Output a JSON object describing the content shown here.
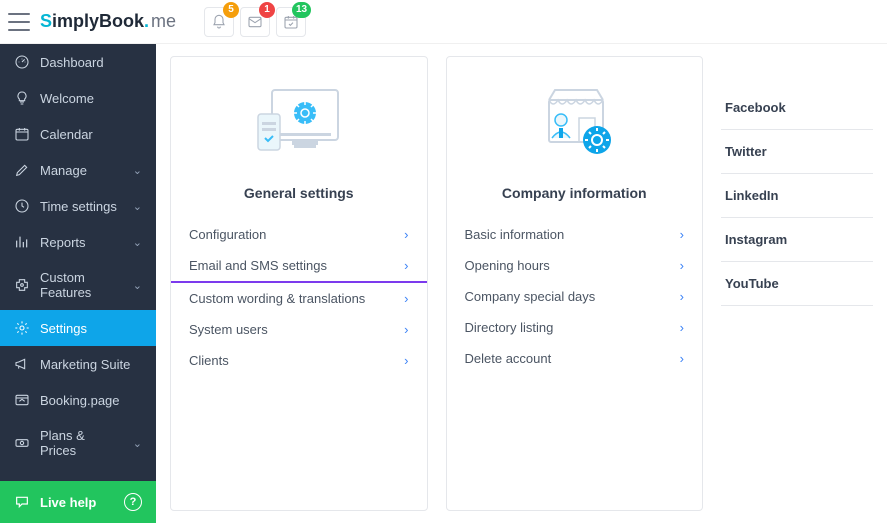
{
  "brand": {
    "prefix": "S",
    "mid": "imply",
    "suffix": "Book",
    "dot": ".",
    "me": "me"
  },
  "topbar": {
    "notifications": {
      "bell": "5",
      "mail": "1",
      "calendar": "13"
    }
  },
  "sidebar": {
    "items": [
      {
        "icon": "dashboard",
        "label": "Dashboard",
        "expandable": false
      },
      {
        "icon": "bulb",
        "label": "Welcome",
        "expandable": false
      },
      {
        "icon": "calendar",
        "label": "Calendar",
        "expandable": false
      },
      {
        "icon": "pencil",
        "label": "Manage",
        "expandable": true
      },
      {
        "icon": "clock",
        "label": "Time settings",
        "expandable": true
      },
      {
        "icon": "chart",
        "label": "Reports",
        "expandable": true
      },
      {
        "icon": "puzzle",
        "label": "Custom Features",
        "expandable": true
      },
      {
        "icon": "gear",
        "label": "Settings",
        "expandable": false,
        "active": true
      },
      {
        "icon": "megaphone",
        "label": "Marketing Suite",
        "expandable": false
      },
      {
        "icon": "browser",
        "label": "Booking.page",
        "expandable": false
      },
      {
        "icon": "money",
        "label": "Plans & Prices",
        "expandable": true
      }
    ],
    "live_help": "Live help"
  },
  "cards": [
    {
      "title": "General settings",
      "links": [
        {
          "label": "Configuration"
        },
        {
          "label": "Email and SMS settings",
          "highlight": true
        },
        {
          "label": "Custom wording & translations"
        },
        {
          "label": "System users"
        },
        {
          "label": "Clients"
        }
      ]
    },
    {
      "title": "Company information",
      "links": [
        {
          "label": "Basic information"
        },
        {
          "label": "Opening hours"
        },
        {
          "label": "Company special days"
        },
        {
          "label": "Directory listing"
        },
        {
          "label": "Delete account"
        }
      ]
    }
  ],
  "social": [
    "Facebook",
    "Twitter",
    "LinkedIn",
    "Instagram",
    "YouTube"
  ]
}
